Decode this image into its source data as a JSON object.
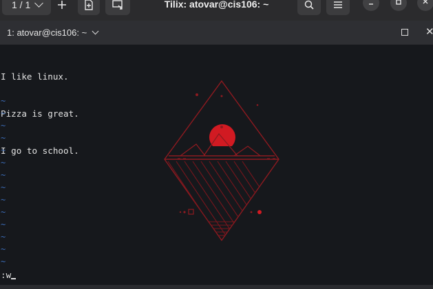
{
  "header": {
    "session_label": "1 / 1",
    "title": "Tilix: atovar@cis106: ~",
    "add_icon": "plus-icon",
    "new_icon": "new-session-icon",
    "detach_icon": "detach-icon",
    "search_icon": "search-icon",
    "menu_icon": "hamburger-menu-icon",
    "minimize_icon": "minimize-icon",
    "maximize_icon": "maximize-icon",
    "close_icon": "close-icon"
  },
  "terminal_tab": {
    "title": "1: atovar@cis106: ~"
  },
  "terminal": {
    "lines": [
      "I like linux.",
      "Pizza is great.",
      "I go to school."
    ],
    "tilde_marker": "~",
    "command": ":w"
  },
  "colors": {
    "accent_red": "#d11a22",
    "tilde_blue": "#3c6cb8",
    "background": "#16181c"
  }
}
